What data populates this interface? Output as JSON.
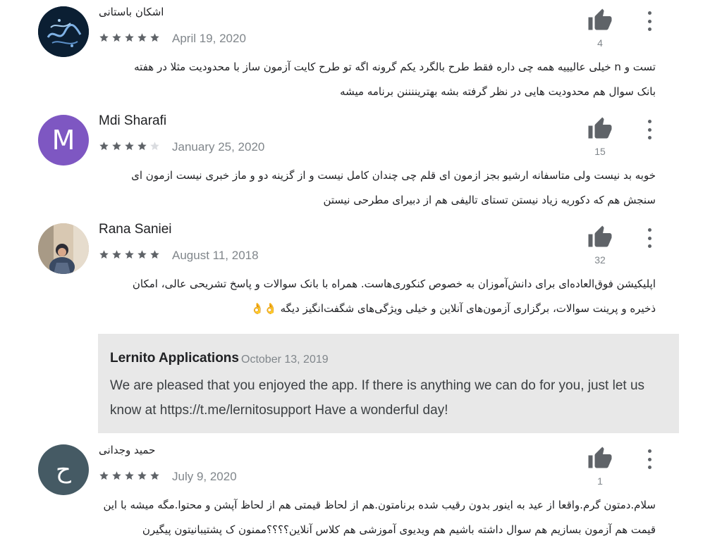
{
  "reviews": [
    {
      "name": "اشکان باستانی",
      "date": "April 19, 2020",
      "rating": 5,
      "helpful_count": "4",
      "text_line1": "تست و n خیلی عالیییه همه چی داره فقط طرح بالگرد یکم گرونه اگه تو طرح کایت آزمون ساز با محدودیت مثلا در هفته",
      "text_line2": "بانک سوال هم محدودیت هایی در نظر گرفته بشه بهتریننننن برنامه میشه",
      "avatar_letter": ""
    },
    {
      "name": "Mdi Sharafi",
      "date": "January 25, 2020",
      "rating": 4,
      "helpful_count": "15",
      "text_line1": "خوبه بد نیست ولی متاسفانه ارشیو بجز ازمون ای قلم چی چندان کامل نیست و از گزینه دو و ماز خبری نیست ازمون ای",
      "text_line2": "سنجش هم که دکوریه زیاد نیستن تستای تالیفی هم از دبیرای مطرحی نیستن",
      "avatar_letter": "M"
    },
    {
      "name": "Rana Saniei",
      "date": "August 11, 2018",
      "rating": 5,
      "helpful_count": "32",
      "text_line1": "اپلیکیشن فوق‌العاده‌ای برای دانش‌آموزان به خصوص کنکوری‌هاست. همراه با بانک سوالات و پاسخ تشریحی عالی، امکان",
      "text_line2": "ذخیره و پرینت سوالات، برگزاری آزمون‌های آنلاین و خیلی ویژگی‌های شگفت‌انگیز دیگه 👌👌",
      "avatar_letter": ""
    },
    {
      "name": "حمید وجدانی",
      "date": "July 9, 2020",
      "rating": 5,
      "helpful_count": "1",
      "text_line1": "سلام.دمتون گرم.واقعا از عید به اینور بدون رقیب شده برنامتون.هم از لحاظ قیمتی هم از لحاظ آپشن و محتوا.مگه میشه با این",
      "text_line2": "قیمت هم آزمون بسازیم هم سوال داشته باشیم هم ویدیوی آموزشی هم کلاس آنلاین؟؟؟؟ممنون ک پشتیبانیتون پیگیرن",
      "avatar_letter": "ح"
    }
  ],
  "reply": {
    "author": "Lernito Applications",
    "date": "October 13, 2019",
    "text": "We are pleased that you enjoyed the app. If there is anything we can do for you, just let us know at https://t.me/lernitosupport Have a wonderful day!"
  },
  "colors": {
    "avatar_mdi": "#7e57c2",
    "avatar_hamid": "#455a64",
    "avatar_ashkan": "#0b1f33",
    "star_filled": "#5f6368",
    "star_empty": "#dadce0",
    "reply_bg": "#e8e8e8"
  },
  "icons": {
    "helpful": "thumbs-up-icon",
    "menu": "more-vert-icon",
    "rating": "star-icon"
  }
}
